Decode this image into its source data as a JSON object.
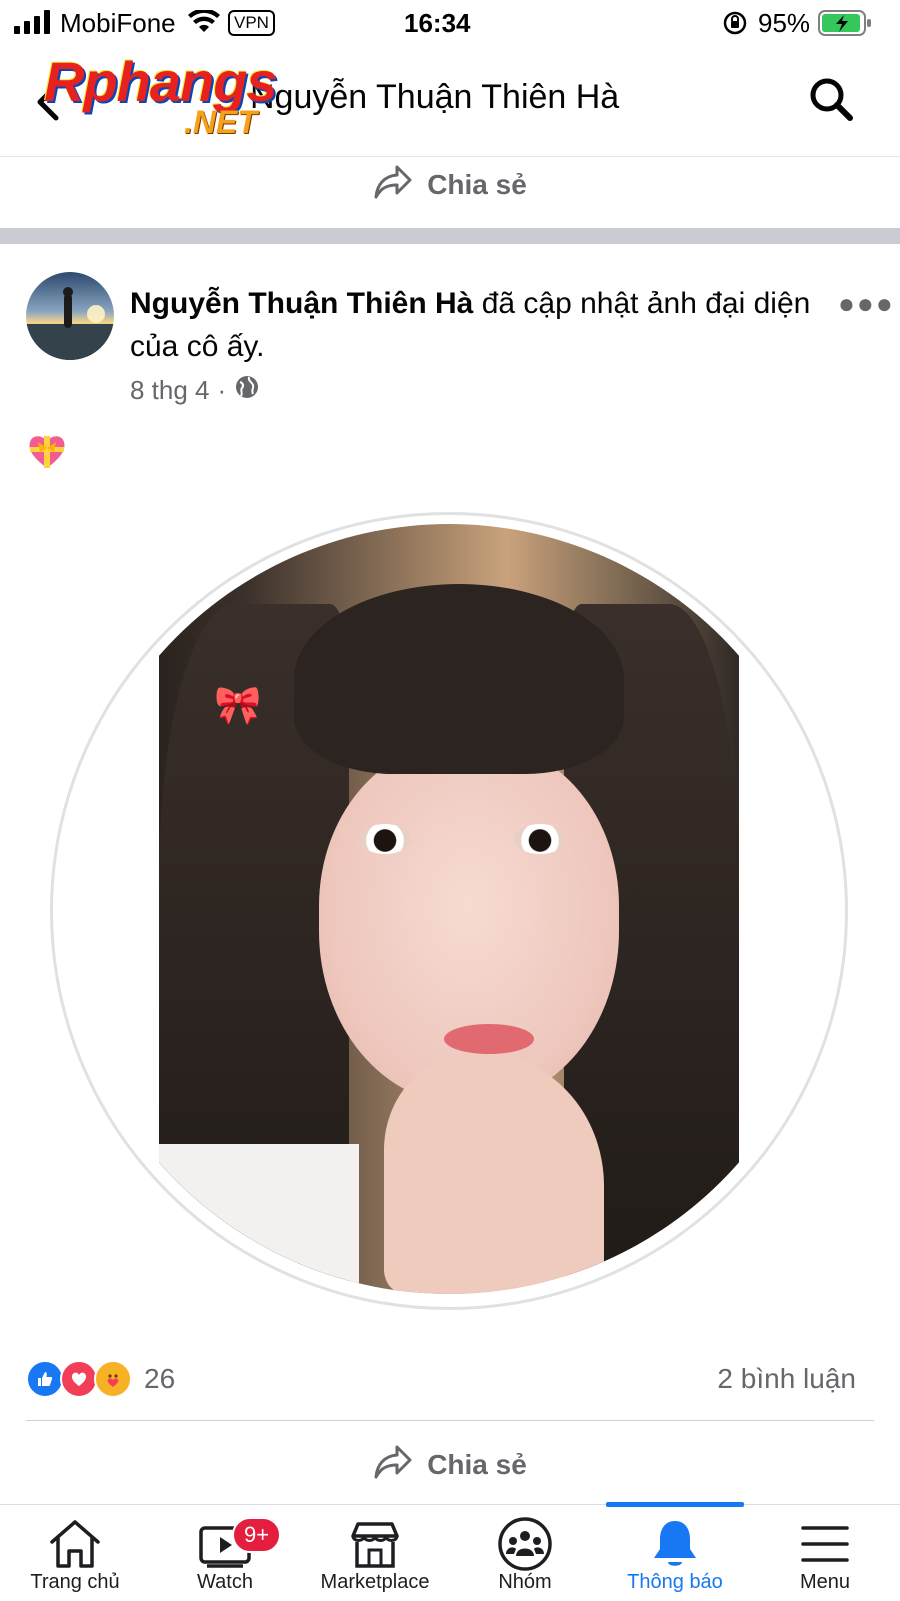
{
  "status_bar": {
    "carrier": "MobiFone",
    "vpn": "VPN",
    "time": "16:34",
    "battery": "95%"
  },
  "header": {
    "title": "Nguyễn Thuận Thiên Hà",
    "watermark_main": "Rphangs",
    "watermark_sub": ".NET"
  },
  "top_share": {
    "label": "Chia sẻ"
  },
  "post": {
    "author": "Nguyễn Thuận Thiên Hà",
    "action": "đã cập nhật ảnh đại diện của cô ấy.",
    "date": "8 thg 4",
    "separator": "·",
    "caption_emoji": "💝",
    "reaction_count": "26",
    "comments": "2 bình luận",
    "share_label": "Chia sẻ"
  },
  "tabs": [
    {
      "label": "Trang chủ",
      "icon": "home-icon"
    },
    {
      "label": "Watch",
      "icon": "watch-icon",
      "badge": "9+"
    },
    {
      "label": "Marketplace",
      "icon": "marketplace-icon"
    },
    {
      "label": "Nhóm",
      "icon": "groups-icon"
    },
    {
      "label": "Thông báo",
      "icon": "bell-icon",
      "active": true
    },
    {
      "label": "Menu",
      "icon": "menu-icon"
    }
  ],
  "colors": {
    "accent": "#1877f2",
    "secondary_text": "#65676b",
    "badge": "#e41e3f"
  }
}
